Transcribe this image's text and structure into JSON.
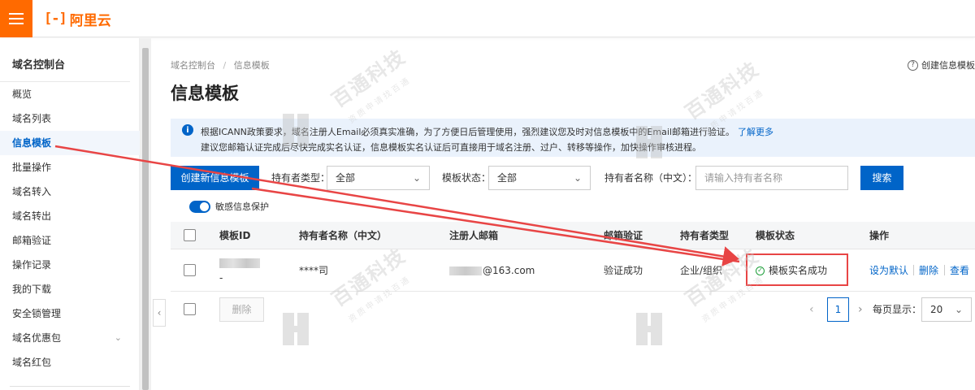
{
  "header": {
    "logo_mark": "[-]",
    "logo_text": "阿里云"
  },
  "sidebar": {
    "title": "域名控制台",
    "items": [
      {
        "label": "概览"
      },
      {
        "label": "域名列表"
      },
      {
        "label": "信息模板",
        "active": true
      },
      {
        "label": "批量操作"
      },
      {
        "label": "域名转入"
      },
      {
        "label": "域名转出"
      },
      {
        "label": "邮箱验证"
      },
      {
        "label": "操作记录"
      },
      {
        "label": "我的下载"
      },
      {
        "label": "安全锁管理"
      },
      {
        "label": "域名优惠包",
        "expandable": true
      },
      {
        "label": "域名红包"
      }
    ]
  },
  "breadcrumb": {
    "root": "域名控制台",
    "separator": "/",
    "current": "信息模板"
  },
  "help_link": "创建信息模板",
  "page_title": "信息模板",
  "notice": {
    "line1": "根据ICANN政策要求，域名注册人Email必须真实准确，为了方便日后管理使用，强烈建议您及时对信息模板中的Email邮箱进行验证。",
    "link": "了解更多",
    "line2": "建议您邮箱认证完成后尽快完成实名认证，信息模板实名认证后可直接用于域名注册、过户、转移等操作，加快操作审核进程。"
  },
  "filters": {
    "create_button": "创建新信息模板",
    "holder_type_label": "持有者类型：",
    "holder_type_value": "全部",
    "status_label": "模板状态：",
    "status_value": "全部",
    "holder_name_label": "持有者名称（中文）：",
    "holder_name_placeholder": "请输入持有者名称",
    "search_button": "搜索"
  },
  "privacy_toggle": {
    "label": "敏感信息保护",
    "on": true
  },
  "table": {
    "columns": [
      "模板ID",
      "持有者名称（中文）",
      "注册人邮箱",
      "邮箱验证",
      "持有者类型",
      "模板状态",
      "操作"
    ],
    "rows": [
      {
        "template_id_suffix": "-",
        "holder_name": "****司",
        "email_suffix": "@163.com",
        "email_verification": "验证成功",
        "holder_type": "企业/组织",
        "status": "模板实名成功",
        "actions": [
          "设为默认",
          "删除",
          "查看"
        ]
      }
    ]
  },
  "footer": {
    "delete_button": "删除",
    "current_page": "1",
    "page_size_label": "每页显示：",
    "page_size": "20"
  },
  "watermark": {
    "main": "百通科技",
    "sub": "资质申请找百通"
  },
  "colors": {
    "brand": "#ff6a00",
    "primary": "#0064c8",
    "highlight": "#e84545",
    "success": "#1e9e3a"
  }
}
